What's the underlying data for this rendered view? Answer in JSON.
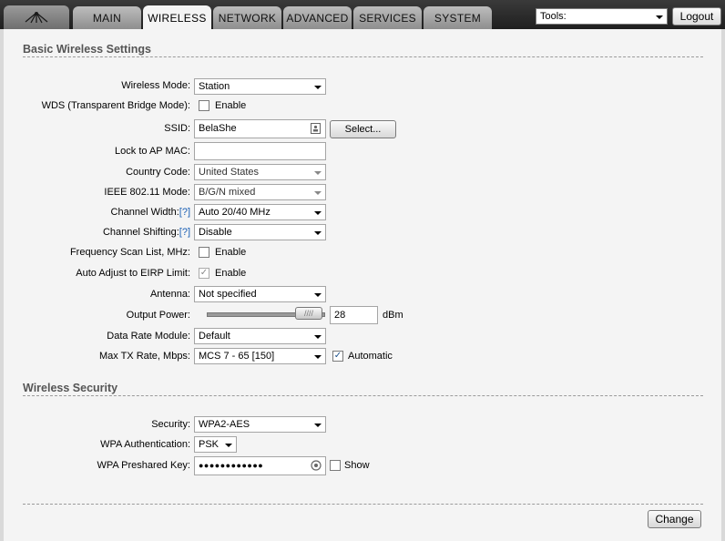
{
  "nav": {
    "tabs": [
      {
        "label": "MAIN"
      },
      {
        "label": "WIRELESS"
      },
      {
        "label": "NETWORK"
      },
      {
        "label": "ADVANCED"
      },
      {
        "label": "SERVICES"
      },
      {
        "label": "SYSTEM"
      }
    ],
    "tools_label": "Tools:",
    "logout_label": "Logout"
  },
  "basic": {
    "title": "Basic Wireless Settings",
    "wireless_mode": {
      "label": "Wireless Mode:",
      "value": "Station"
    },
    "wds": {
      "label": "WDS (Transparent Bridge Mode):",
      "option": "Enable"
    },
    "ssid": {
      "label": "SSID:",
      "value": "BelaShe",
      "button": "Select..."
    },
    "lock_ap_mac": {
      "label": "Lock to AP MAC:",
      "value": ""
    },
    "country_code": {
      "label": "Country Code:",
      "value": "United States"
    },
    "ieee_mode": {
      "label": "IEEE 802.11 Mode:",
      "value": "B/G/N mixed"
    },
    "channel_width": {
      "label": "Channel Width:",
      "help": "[?]",
      "value": "Auto 20/40 MHz"
    },
    "channel_shifting": {
      "label": "Channel Shifting:",
      "help": "[?]",
      "value": "Disable"
    },
    "freq_scan": {
      "label": "Frequency Scan List, MHz:",
      "option": "Enable"
    },
    "auto_eirp": {
      "label": "Auto Adjust to EIRP Limit:",
      "option": "Enable"
    },
    "antenna": {
      "label": "Antenna:",
      "value": "Not specified"
    },
    "output_power": {
      "label": "Output Power:",
      "value": "28",
      "unit": "dBm"
    },
    "data_rate_module": {
      "label": "Data Rate Module:",
      "value": "Default"
    },
    "max_tx_rate": {
      "label": "Max TX Rate, Mbps:",
      "value": "MCS 7 - 65 [150]",
      "option": "Automatic"
    }
  },
  "security": {
    "title": "Wireless Security",
    "security": {
      "label": "Security:",
      "value": "WPA2-AES"
    },
    "wpa_auth": {
      "label": "WPA Authentication:",
      "value": "PSK"
    },
    "wpa_key": {
      "label": "WPA Preshared Key:",
      "value": "●●●●●●●●●●●●",
      "option": "Show"
    }
  },
  "footer": {
    "change_label": "Change"
  },
  "icons": {
    "logo": "ubiquiti-logo-icon",
    "dropdown": "chevron-down-icon",
    "ssid_field": "contact-card-icon",
    "key_field": "key-visibility-icon"
  }
}
